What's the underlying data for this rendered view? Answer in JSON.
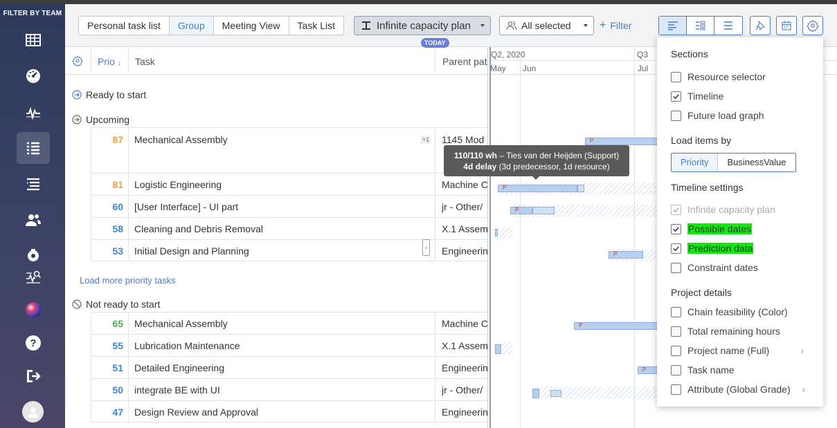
{
  "sidebar": {
    "filter_label": "FILTER BY TEAM",
    "items": [
      {
        "icon": "grid-icon"
      },
      {
        "icon": "dashboard-gauge-icon"
      },
      {
        "icon": "pulse-icon"
      },
      {
        "icon": "task-list-icon"
      },
      {
        "icon": "indented-list-icon"
      },
      {
        "icon": "users-icon"
      },
      {
        "icon": "camera-settings-icon"
      },
      {
        "icon": "search-pulse-icon"
      },
      {
        "icon": "color-orb-icon"
      },
      {
        "icon": "help-icon"
      },
      {
        "icon": "logout-icon"
      },
      {
        "icon": "avatar-icon"
      }
    ]
  },
  "toolbar": {
    "tabs": [
      {
        "label": "Personal task list"
      },
      {
        "label": "Group"
      },
      {
        "label": "Meeting View"
      },
      {
        "label": "Task List"
      }
    ],
    "active_tab": "Group",
    "plan_select": "Infinite capacity plan",
    "people_select": "All selected",
    "filter_label": "Filter"
  },
  "table": {
    "headers": {
      "prio": "Prio",
      "task": "Task",
      "parent": "Parent pat"
    },
    "groups": {
      "ready": "Ready to start",
      "upcoming": "Upcoming",
      "not_ready": "Not ready to start"
    },
    "upcoming_rows": [
      {
        "prio": "87",
        "task": "Mechanical Assembly",
        "parent": "1145 Mod",
        "badge": "+1",
        "color": "#e8a33d"
      },
      {
        "prio": "81",
        "task": "Logistic Engineering",
        "parent": "Machine C",
        "color": "#e8a33d"
      },
      {
        "prio": "60",
        "task": "[User Interface] - UI part",
        "parent": "jr - Other/",
        "color": "#3a86d4"
      },
      {
        "prio": "58",
        "task": "Cleaning and Debris Removal",
        "parent": "X.1 Assem",
        "color": "#3a86d4"
      },
      {
        "prio": "53",
        "task": "Initial Design and Planning",
        "parent": "Engineerin",
        "color": "#3a86d4"
      }
    ],
    "load_more": "Load more priority tasks",
    "not_ready_rows": [
      {
        "prio": "65",
        "task": "Mechanical Assembly",
        "parent": "Machine C",
        "color": "#4caf50"
      },
      {
        "prio": "55",
        "task": "Lubrication Maintenance",
        "parent": "X.1 Assem",
        "color": "#3a86d4"
      },
      {
        "prio": "51",
        "task": "Detailed Engineering",
        "parent": "Engineerin",
        "color": "#3a86d4"
      },
      {
        "prio": "50",
        "task": "integrate BE with UI",
        "parent": "jr - Other/",
        "color": "#3a86d4"
      },
      {
        "prio": "47",
        "task": "Design Review and Approval",
        "parent": "Engineerin",
        "color": "#3a86d4"
      }
    ]
  },
  "gantt": {
    "today": "TODAY",
    "quarter1": "Q2, 2020",
    "quarter2": "Q3",
    "months": [
      "May",
      "Jun",
      "Jul"
    ],
    "bar_marker": "P"
  },
  "tooltip": {
    "line1_bold": "110/110 wh",
    "line1_rest": " – Ties van der Heijden (Support)",
    "line2_bold": "4d delay",
    "line2_rest": " (3d predecessor, 1d resource)"
  },
  "panel": {
    "sections_title": "Sections",
    "sections": [
      {
        "label": "Resource selector",
        "checked": false
      },
      {
        "label": "Timeline",
        "checked": true
      },
      {
        "label": "Future load graph",
        "checked": false
      }
    ],
    "load_items_title": "Load items by",
    "load_items": [
      "Priority",
      "BusinessValue"
    ],
    "load_items_active": "Priority",
    "timeline_title": "Timeline settings",
    "timeline": [
      {
        "label": "Infinite capacity plan",
        "checked": true,
        "disabled": true
      },
      {
        "label": "Possible dates",
        "checked": true,
        "highlight": true
      },
      {
        "label": "Prediction data",
        "checked": true,
        "highlight": true
      },
      {
        "label": "Constraint dates",
        "checked": false
      }
    ],
    "project_title": "Project details",
    "project": [
      {
        "label": "Chain feasibility (Color)",
        "checked": false
      },
      {
        "label": "Total remaining hours",
        "checked": false
      },
      {
        "label": "Project name (Full)",
        "checked": false,
        "submenu": true
      },
      {
        "label": "Task name",
        "checked": false
      },
      {
        "label": "Attribute (Global Grade)",
        "checked": false,
        "submenu": true
      }
    ],
    "highlight_color": "#11e80f"
  },
  "colors": {
    "accent": "#4a7dc3",
    "sidebar": "#2e3a5c",
    "prio_orange": "#e8a33d",
    "prio_blue": "#3a86d4",
    "prio_green": "#4caf50"
  }
}
